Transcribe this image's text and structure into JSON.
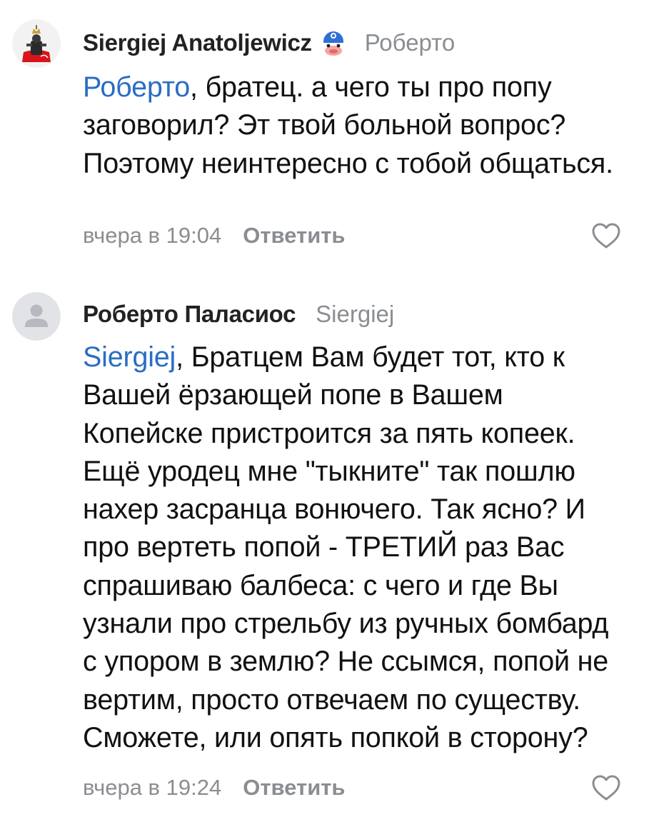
{
  "comments": [
    {
      "author": "Siergiej Anatoljewicz",
      "reply_to": "Роберто",
      "mention": "Роберто",
      "text": ", братец. а чего ты про попу заговорил? Эт твой больной вопрос? Поэтому неинтересно с тобой общаться.",
      "time": "вчера в 19:04",
      "reply_label": "Ответить",
      "avatar_icon": "emblem-avatar",
      "badge_icon": "mask-badge-icon",
      "like_icon": "heart-icon"
    },
    {
      "author": "Роберто Паласиос",
      "reply_to": "Siergiej",
      "mention": "Siergiej",
      "text": ", Братцем Вам будет тот, кто к Вашей ёрзающей попе в Вашем Копейске пристроится за пять копеек. Ещё уродец мне \"тыкните\" так пошлю нахер засранца вонючего. Так ясно? И про вертеть попой - ТРЕТИЙ раз Вас спрашиваю балбеса: с чего и где Вы узнали про стрельбу из ручных бомбард с упором в землю? Не ссымся, попой не вертим, просто отвечаем по существу. Сможете, или опять попкой в сторону?",
      "time": "вчера в 19:24",
      "reply_label": "Ответить",
      "avatar_icon": "default-user-avatar",
      "like_icon": "heart-icon"
    }
  ],
  "colors": {
    "mention": "#2a6dc4",
    "muted": "#8a8d91",
    "text": "#111111",
    "placeholder_avatar": "#e1e3e6",
    "placeholder_glyph": "#b6bac0"
  }
}
